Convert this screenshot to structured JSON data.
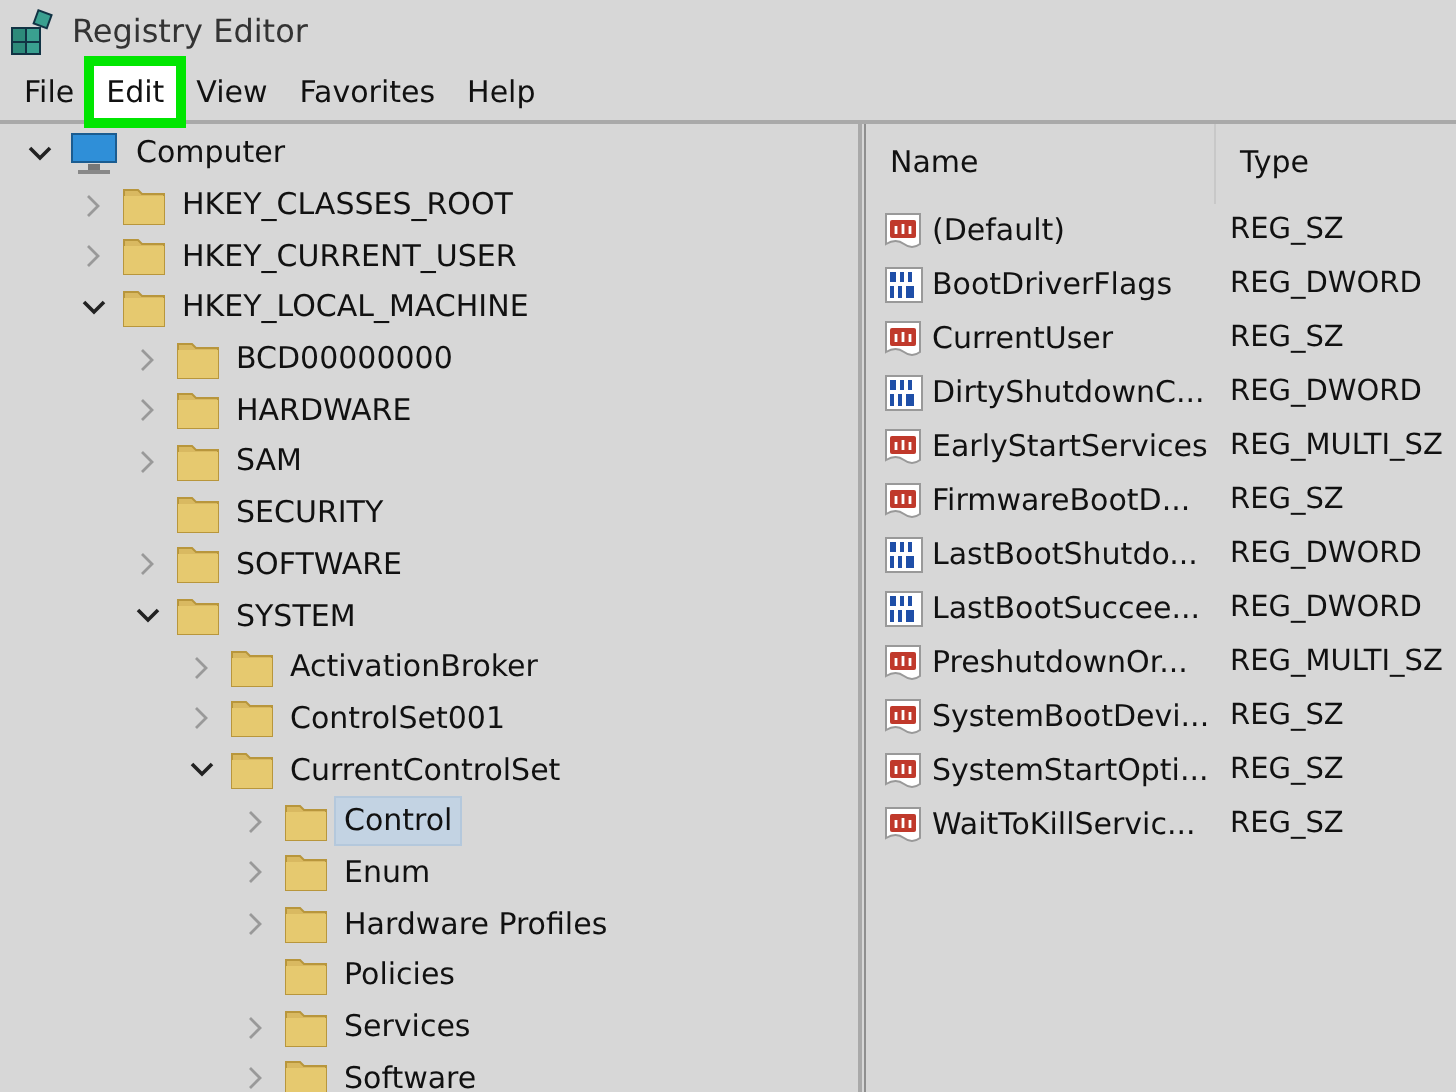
{
  "window": {
    "title": "Registry Editor"
  },
  "menu": [
    {
      "label": "File",
      "highlighted": false
    },
    {
      "label": "Edit",
      "highlighted": true
    },
    {
      "label": "View",
      "highlighted": false
    },
    {
      "label": "Favorites",
      "highlighted": false
    },
    {
      "label": "Help",
      "highlighted": false
    }
  ],
  "tree": {
    "label": "Computer",
    "expandable": true,
    "expanded": true,
    "selected": false,
    "children": [
      {
        "label": "HKEY_CLASSES_ROOT",
        "expandable": true,
        "expanded": false,
        "selected": false
      },
      {
        "label": "HKEY_CURRENT_USER",
        "expandable": true,
        "expanded": false,
        "selected": false
      },
      {
        "label": "HKEY_LOCAL_MACHINE",
        "expandable": true,
        "expanded": true,
        "selected": false,
        "children": [
          {
            "label": "BCD00000000",
            "expandable": true,
            "expanded": false,
            "selected": false
          },
          {
            "label": "HARDWARE",
            "expandable": true,
            "expanded": false,
            "selected": false
          },
          {
            "label": "SAM",
            "expandable": true,
            "expanded": false,
            "selected": false
          },
          {
            "label": "SECURITY",
            "expandable": false,
            "selected": false
          },
          {
            "label": "SOFTWARE",
            "expandable": true,
            "expanded": false,
            "selected": false
          },
          {
            "label": "SYSTEM",
            "expandable": true,
            "expanded": true,
            "selected": false,
            "children": [
              {
                "label": "ActivationBroker",
                "expandable": true,
                "expanded": false,
                "selected": false
              },
              {
                "label": "ControlSet001",
                "expandable": true,
                "expanded": false,
                "selected": false
              },
              {
                "label": "CurrentControlSet",
                "expandable": true,
                "expanded": true,
                "selected": false,
                "children": [
                  {
                    "label": "Control",
                    "expandable": true,
                    "expanded": false,
                    "selected": true
                  },
                  {
                    "label": "Enum",
                    "expandable": true,
                    "expanded": false,
                    "selected": false
                  },
                  {
                    "label": "Hardware Profiles",
                    "expandable": true,
                    "expanded": false,
                    "selected": false
                  },
                  {
                    "label": "Policies",
                    "expandable": false,
                    "selected": false
                  },
                  {
                    "label": "Services",
                    "expandable": true,
                    "expanded": false,
                    "selected": false
                  },
                  {
                    "label": "Software",
                    "expandable": true,
                    "expanded": false,
                    "selected": false
                  }
                ]
              }
            ]
          }
        ]
      }
    ]
  },
  "values": {
    "columns": [
      "Name",
      "Type"
    ],
    "rows": [
      {
        "name": "(Default)",
        "type": "REG_SZ",
        "kind": "string"
      },
      {
        "name": "BootDriverFlags",
        "type": "REG_DWORD",
        "kind": "binary"
      },
      {
        "name": "CurrentUser",
        "type": "REG_SZ",
        "kind": "string"
      },
      {
        "name": "DirtyShutdownC...",
        "type": "REG_DWORD",
        "kind": "binary"
      },
      {
        "name": "EarlyStartServices",
        "type": "REG_MULTI_SZ",
        "kind": "string"
      },
      {
        "name": "FirmwareBootD...",
        "type": "REG_SZ",
        "kind": "string"
      },
      {
        "name": "LastBootShutdo...",
        "type": "REG_DWORD",
        "kind": "binary"
      },
      {
        "name": "LastBootSuccee...",
        "type": "REG_DWORD",
        "kind": "binary"
      },
      {
        "name": "PreshutdownOr...",
        "type": "REG_MULTI_SZ",
        "kind": "string"
      },
      {
        "name": "SystemBootDevi...",
        "type": "REG_SZ",
        "kind": "string"
      },
      {
        "name": "SystemStartOpti...",
        "type": "REG_SZ",
        "kind": "string"
      },
      {
        "name": "WaitToKillServic...",
        "type": "REG_SZ",
        "kind": "string"
      }
    ]
  }
}
